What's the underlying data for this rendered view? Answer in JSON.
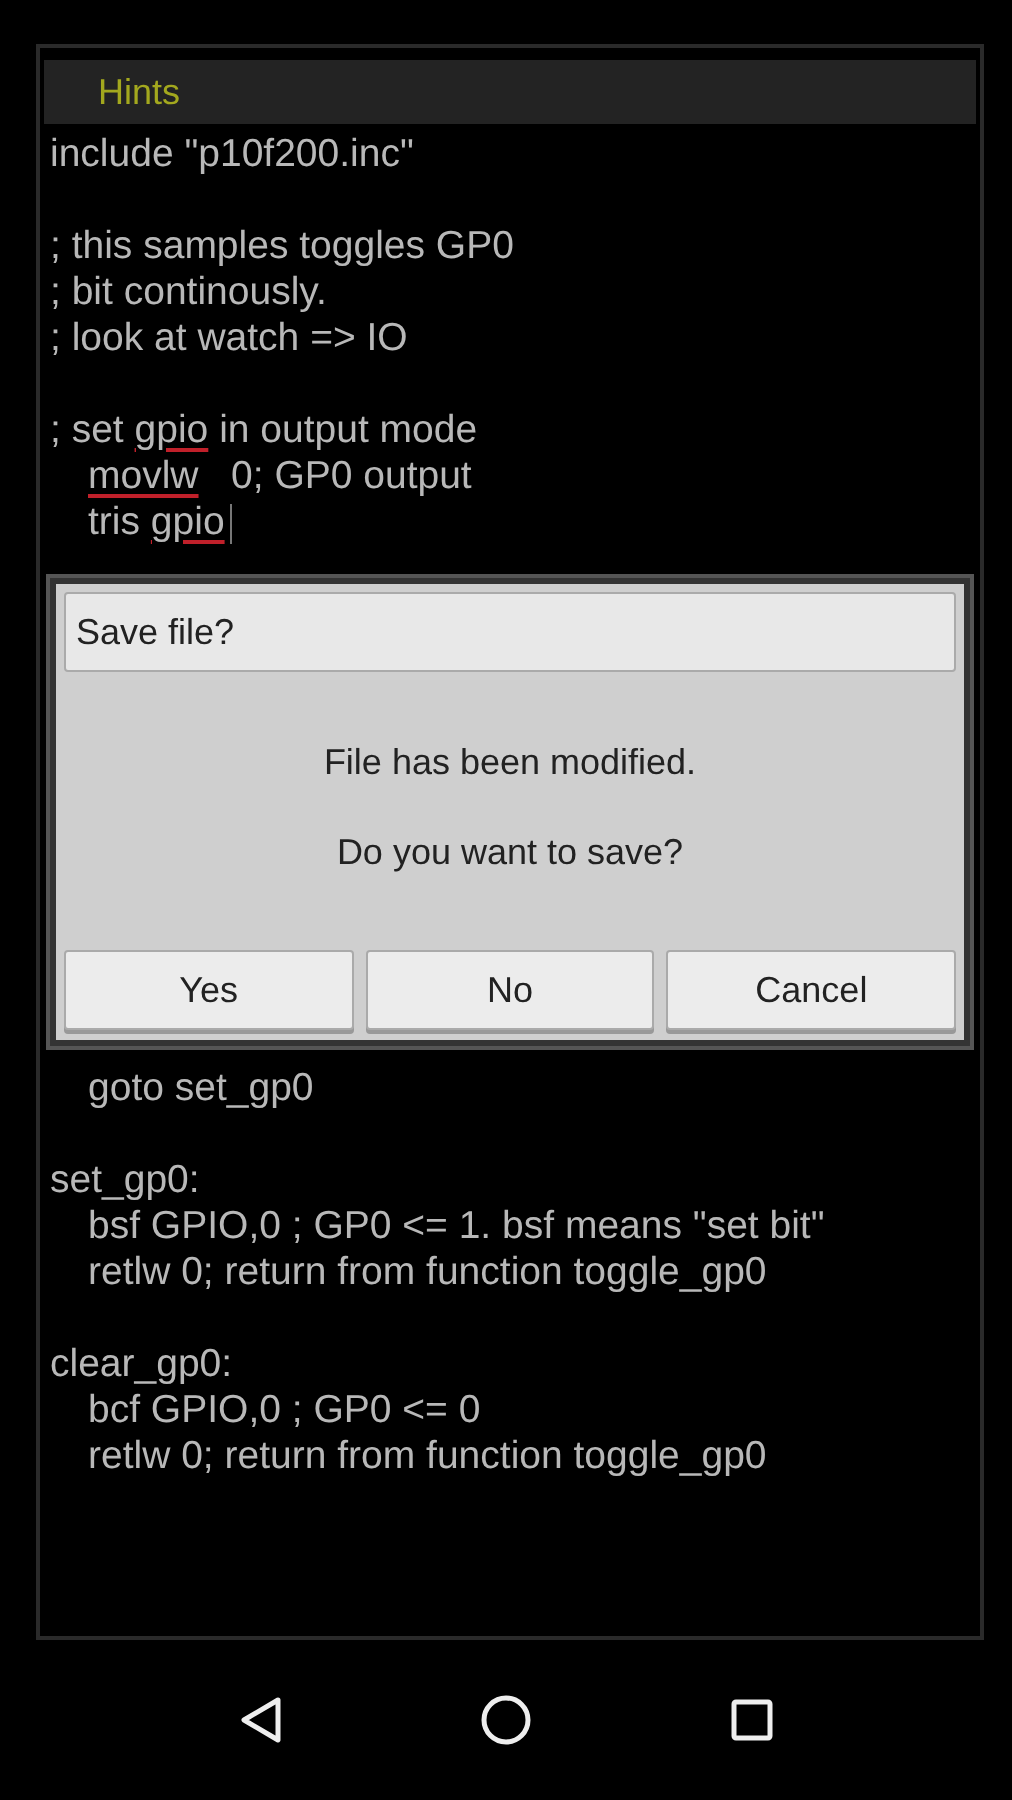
{
  "hints_bar": {
    "label": "Hints"
  },
  "code_before": [
    {
      "kind": "code",
      "indented": false,
      "cursor": false,
      "segments": [
        {
          "text": "include \"p10f200.inc\"",
          "misspelled": false
        }
      ]
    },
    {
      "kind": "blank"
    },
    {
      "kind": "code",
      "indented": false,
      "cursor": false,
      "segments": [
        {
          "text": "; this samples toggles GP0",
          "misspelled": false
        }
      ]
    },
    {
      "kind": "code",
      "indented": false,
      "cursor": false,
      "segments": [
        {
          "text": "; bit continously.",
          "misspelled": false
        }
      ]
    },
    {
      "kind": "code",
      "indented": false,
      "cursor": false,
      "segments": [
        {
          "text": "; look at watch => IO",
          "misspelled": false
        }
      ]
    },
    {
      "kind": "blank"
    },
    {
      "kind": "code",
      "indented": false,
      "cursor": false,
      "segments": [
        {
          "text": "; set ",
          "misspelled": false
        },
        {
          "text": "gpio",
          "misspelled": true
        },
        {
          "text": " in output mode",
          "misspelled": false
        }
      ]
    },
    {
      "kind": "code",
      "indented": true,
      "cursor": false,
      "segments": [
        {
          "text": "movlw",
          "misspelled": true
        },
        {
          "text": "   0; GP0 output",
          "misspelled": false
        }
      ]
    },
    {
      "kind": "code",
      "indented": true,
      "cursor": true,
      "segments": [
        {
          "text": "tris ",
          "misspelled": false
        },
        {
          "text": "gpio",
          "misspelled": true
        }
      ]
    }
  ],
  "dialog": {
    "title": "Save file?",
    "message": [
      "File has been modified.",
      "Do you want to save?"
    ],
    "buttons": [
      "Yes",
      "No",
      "Cancel"
    ]
  },
  "code_after": [
    {
      "kind": "code",
      "indented": true,
      "cursor": false,
      "segments": [
        {
          "text": "goto set_gp0",
          "misspelled": false
        }
      ]
    },
    {
      "kind": "blank"
    },
    {
      "kind": "code",
      "indented": false,
      "cursor": false,
      "segments": [
        {
          "text": "set_gp0:",
          "misspelled": false
        }
      ]
    },
    {
      "kind": "code",
      "indented": true,
      "cursor": false,
      "segments": [
        {
          "text": "bsf GPIO,0 ; GP0 <= 1. bsf means \"set bit\"",
          "misspelled": false
        }
      ]
    },
    {
      "kind": "code",
      "indented": true,
      "cursor": false,
      "segments": [
        {
          "text": "retlw 0; return from function toggle_gp0",
          "misspelled": false
        }
      ]
    },
    {
      "kind": "blank"
    },
    {
      "kind": "code",
      "indented": false,
      "cursor": false,
      "segments": [
        {
          "text": "clear_gp0:",
          "misspelled": false
        }
      ]
    },
    {
      "kind": "code",
      "indented": true,
      "cursor": false,
      "segments": [
        {
          "text": "bcf GPIO,0 ; GP0 <= 0",
          "misspelled": false
        }
      ]
    },
    {
      "kind": "code",
      "indented": true,
      "cursor": false,
      "segments": [
        {
          "text": "retlw 0; return from function toggle_gp0",
          "misspelled": false
        }
      ]
    }
  ]
}
